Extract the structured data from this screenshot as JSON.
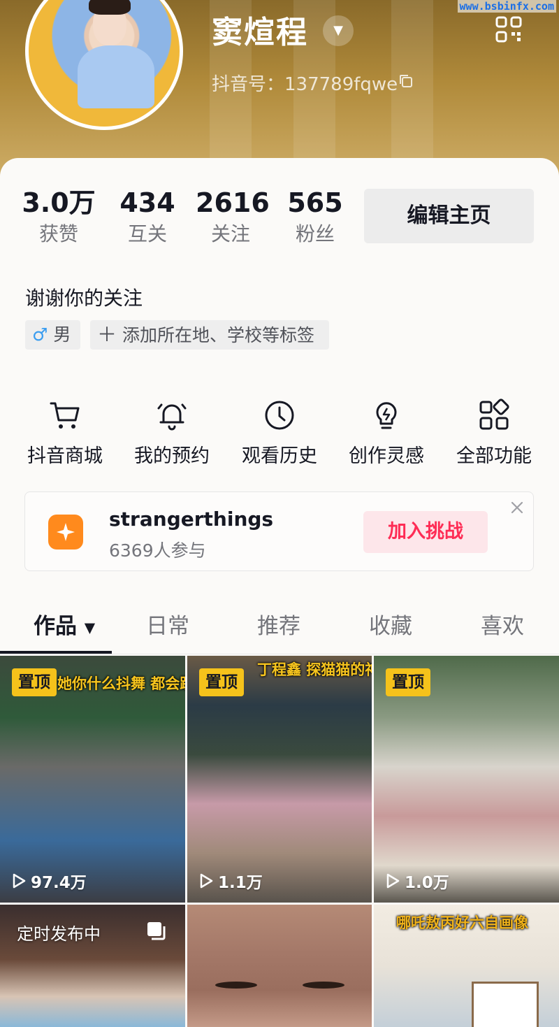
{
  "watermark": "www.bsbinfx.com",
  "profile": {
    "name": "窦煊程",
    "douyin_id": "抖音号：137789fqwe"
  },
  "stats": [
    {
      "value": "3.0万",
      "label": "获赞"
    },
    {
      "value": "434",
      "label": "互关"
    },
    {
      "value": "2616",
      "label": "关注"
    },
    {
      "value": "565",
      "label": "粉丝"
    }
  ],
  "edit_button": "编辑主页",
  "bio": "谢谢你的关注",
  "tags": {
    "gender": "男",
    "add_location": "添加所在地、学校等标签"
  },
  "features": [
    {
      "label": "抖音商城",
      "icon": "cart-icon"
    },
    {
      "label": "我的预约",
      "icon": "bell-icon"
    },
    {
      "label": "观看历史",
      "icon": "clock-icon"
    },
    {
      "label": "创作灵感",
      "icon": "lightbulb-icon"
    },
    {
      "label": "全部功能",
      "icon": "grid-icon"
    }
  ],
  "challenge": {
    "title": "strangerthings",
    "participants": "6369人参与",
    "button": "加入挑战"
  },
  "tabs": [
    "作品",
    "日常",
    "推荐",
    "收藏",
    "喜欢"
  ],
  "videos": [
    {
      "badge": "置顶",
      "views": "97.4万",
      "caption": "她你什么抖舞 都会跳啊"
    },
    {
      "badge": "置顶",
      "views": "1.1万",
      "caption": "丁程鑫 探猫猫的神"
    },
    {
      "badge": "置顶",
      "views": "1.0万",
      "caption": ""
    },
    {
      "badge": "",
      "views": "",
      "caption": "",
      "scheduled": "定时发布中"
    },
    {
      "badge": "",
      "views": "",
      "caption": ""
    },
    {
      "badge": "",
      "views": "",
      "caption": "哪吒敖丙好六自画像"
    }
  ],
  "colors": {
    "accent_red": "#fe2c55",
    "pin_yellow": "#f5c21b",
    "header_gold": "#b08a3a",
    "challenge_orange": "#ff8a1d"
  }
}
